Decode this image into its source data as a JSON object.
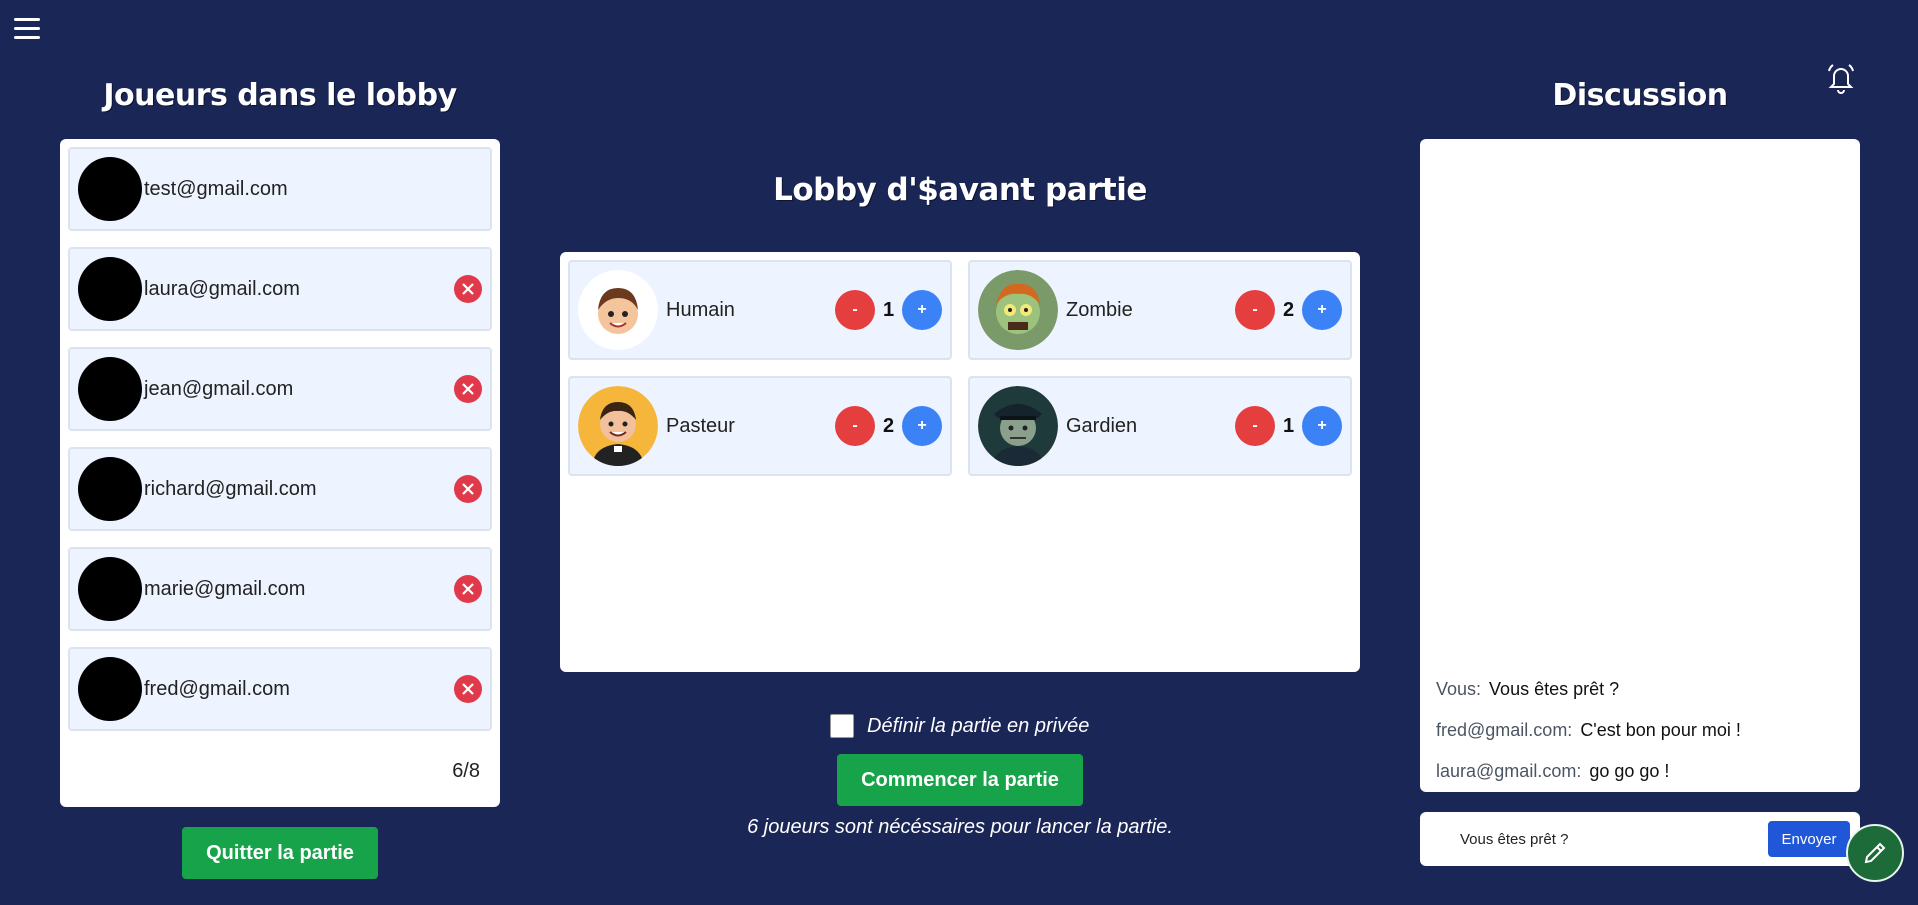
{
  "players": {
    "title": "Joueurs dans le lobby",
    "list": [
      {
        "email": "test@gmail.com",
        "kickable": false
      },
      {
        "email": "laura@gmail.com",
        "kickable": true
      },
      {
        "email": "jean@gmail.com",
        "kickable": true
      },
      {
        "email": "richard@gmail.com",
        "kickable": true
      },
      {
        "email": "marie@gmail.com",
        "kickable": true
      },
      {
        "email": "fred@gmail.com",
        "kickable": true
      }
    ],
    "count": "6/8",
    "quit_label": "Quitter la partie"
  },
  "lobby": {
    "title": "Lobby d'$avant partie",
    "roles": [
      {
        "name": "Humain",
        "count": "1",
        "minus": "-",
        "plus": "+"
      },
      {
        "name": "Zombie",
        "count": "2",
        "minus": "-",
        "plus": "+"
      },
      {
        "name": "Pasteur",
        "count": "2",
        "minus": "-",
        "plus": "+"
      },
      {
        "name": "Gardien",
        "count": "1",
        "minus": "-",
        "plus": "+"
      }
    ],
    "private_label": "Définir la partie en privée",
    "start_label": "Commencer la partie",
    "requirement": "6 joueurs sont nécéssaires pour lancer la partie."
  },
  "chat": {
    "title": "Discussion",
    "messages": [
      {
        "author": "Vous:",
        "text": "Vous êtes prêt ?"
      },
      {
        "author": "fred@gmail.com:",
        "text": "C'est bon pour moi !"
      },
      {
        "author": "laura@gmail.com:",
        "text": "go go go !"
      }
    ],
    "input_value": "Vous êtes prêt ?",
    "send_label": "Envoyer"
  },
  "colors": {
    "background": "#1a2655",
    "accent_green": "#17a34a",
    "minus_red": "#e53e3e",
    "plus_blue": "#3b82f6",
    "send_blue": "#2057d8"
  }
}
